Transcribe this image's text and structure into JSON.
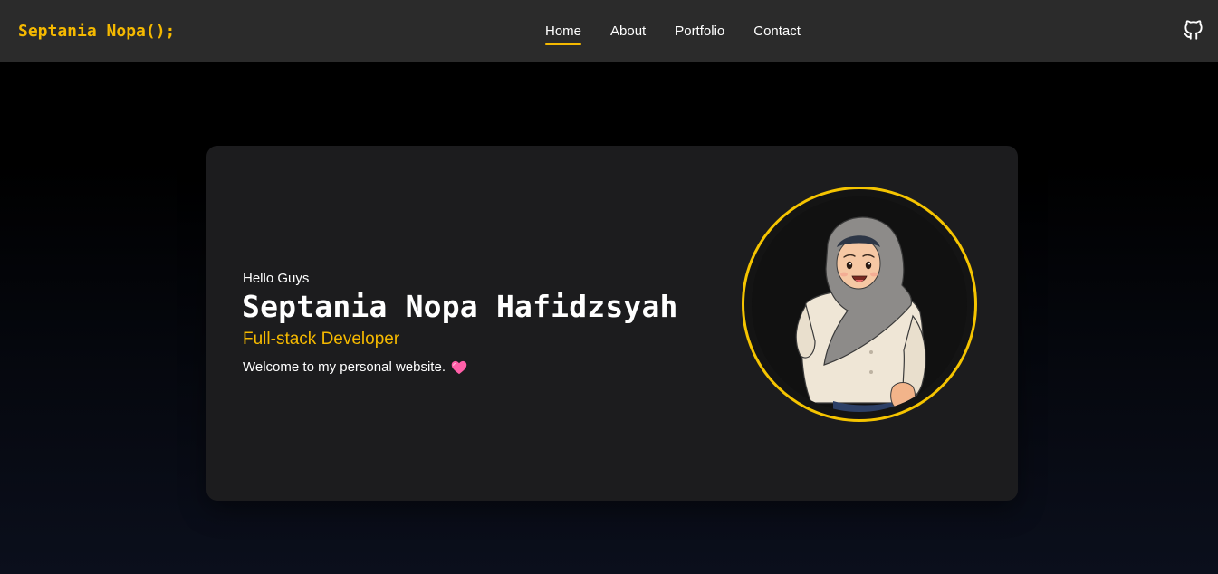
{
  "brand": {
    "name": "Septania Nopa();"
  },
  "nav": {
    "items": [
      {
        "label": "Home",
        "active": true
      },
      {
        "label": "About",
        "active": false
      },
      {
        "label": "Portfolio",
        "active": false
      },
      {
        "label": "Contact",
        "active": false
      }
    ],
    "github_icon": "github-icon"
  },
  "hero": {
    "greeting": "Hello Guys",
    "name": "Septania Nopa Hafidzsyah",
    "role": "Full-stack Developer",
    "welcome": "Welcome to my personal website.",
    "welcome_icon": "pink-heart-icon",
    "avatar": "avatar-illustration"
  },
  "colors": {
    "accent": "#f5b900",
    "navbar": "#2b2b2b",
    "card": "#1c1c1e",
    "heart": "#ff5fa8"
  }
}
